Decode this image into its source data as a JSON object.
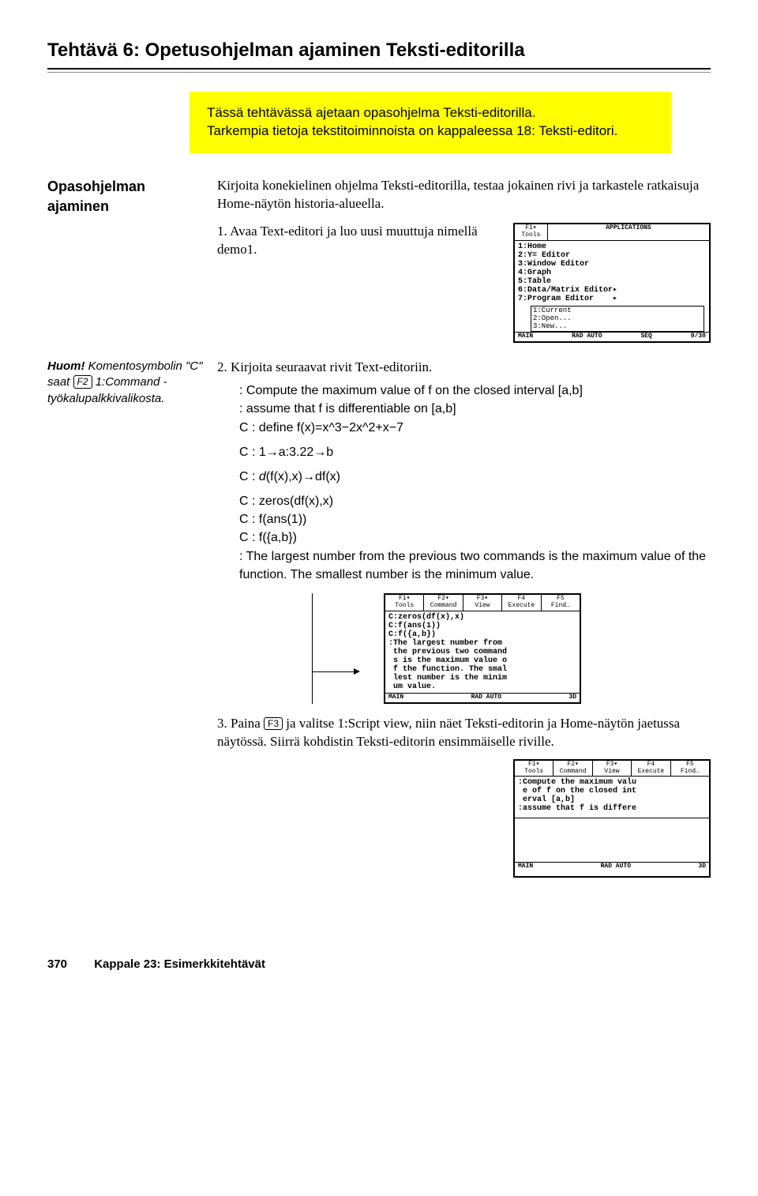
{
  "title": "Tehtävä 6: Opetusohjelman ajaminen Teksti-editorilla",
  "highlight": {
    "line1": "Tässä tehtävässä ajetaan opasohjelma Teksti-editorilla.",
    "line2": "Tarkempia tietoja tekstitoiminnoista on kappaleessa 18: Teksti-editori."
  },
  "section1": {
    "label": "Opasohjelman ajaminen",
    "intro": "Kirjoita konekielinen ohjelma Teksti-editorilla, testaa jokainen rivi ja tarkastele ratkaisuja Home-näytön historia-alueella.",
    "step1": "Avaa Text-editori ja luo uusi muuttuja nimellä demo1."
  },
  "calc1": {
    "menu_f1": "F1▾\nTools",
    "title": "APPLICATIONS",
    "lines": "1:Home\n2:Y= Editor\n3:Window Editor\n4:Graph\n5:Table\n6:Data/Matrix Editor▸\n7:Program Editor    ▸",
    "popup": "1:Current\n2:Open...\n3:New...",
    "status_l": "MAIN",
    "status_m": "RAD AUTO",
    "status_r": "SEQ",
    "status_n": "0/30"
  },
  "sidenote": {
    "pre": "Huom!",
    "body": " Komentosymbolin \"C\" saat ",
    "key": "F2",
    "post": " 1:Command -työkalupalkkivalikosta."
  },
  "step2": {
    "lead": "Kirjoita seuraavat rivit Text-editoriin.",
    "l1": ": Compute the maximum value of f on the closed interval [a,b]",
    "l2": ": assume that f is differentiable on [a,b]",
    "l3": "C : define f(x)=x^3−2x^2+x−7",
    "l4_pre": "C : 1",
    "l4_a": "a:3.22",
    "l4_b": "b",
    "l5_pre": "C : ",
    "l5_ital": "d",
    "l5_mid": "(f(x),x)",
    "l5_post": "df(x)",
    "l6": "C : zeros(df(x),x)",
    "l7": "C : f(ans(1))",
    "l8": "C : f({a,b})",
    "l9": ": The largest number from the previous two commands is the maximum value of the function. The smallest number is the minimum value."
  },
  "calc2": {
    "m": [
      "F1▾\nTools",
      "F2▾\nCommand",
      "F3▾\nView",
      "F4\nExecute",
      "F5\nFind…"
    ],
    "body": "C:zeros(df(x),x)\nC:f(ans(1))\nC:f({a,b})\n:The largest number from\n the previous two command\n s is the maximum value o\n f the function. The smal\n lest number is the minim\n um value.",
    "status_l": "MAIN",
    "status_m": "RAD AUTO",
    "status_r": "3D"
  },
  "step3": {
    "pre": "Paina ",
    "key": "F3",
    "post": " ja valitse 1:Script view, niin näet Teksti-editorin ja Home-näytön jaetussa näytössä. Siirrä kohdistin Teksti-editorin ensimmäiselle riville."
  },
  "calc3": {
    "m": [
      "F1▾\nTools",
      "F2▾\nCommand",
      "F3▾\nView",
      "F4\nExecute",
      "F5\nFind…"
    ],
    "body": ":Compute the maximum valu\n e of f on the closed int\n erval [a,b]\n:assume that f is differe",
    "status_l": "MAIN",
    "status_m": "RAD AUTO",
    "status_r": "3D"
  },
  "footer": {
    "page": "370",
    "chapter": "Kappale 23: Esimerkkitehtävät"
  }
}
